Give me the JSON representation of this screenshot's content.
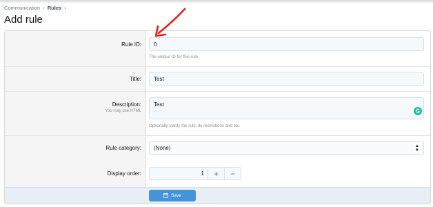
{
  "breadcrumb": {
    "item1": "Communication",
    "item2": "Rules"
  },
  "page": {
    "title": "Add rule"
  },
  "form": {
    "rule_id": {
      "label": "Rule ID:",
      "value": "0",
      "explain": "The unique ID for this rule."
    },
    "title": {
      "label": "Title:",
      "value": "Test"
    },
    "description": {
      "label": "Description:",
      "hint": "You may use HTML",
      "value": "Test",
      "explain": "Optionally clarify the rule, its restrictions and etc."
    },
    "category": {
      "label": "Rule category:",
      "value": "(None)"
    },
    "display_order": {
      "label": "Display order:",
      "value": "1",
      "plus": "+",
      "minus": "−"
    },
    "save_label": "Save"
  },
  "colors": {
    "accent": "#4594d9",
    "annotation_arrow": "#e0201b",
    "grammarly": "#15c39a"
  }
}
